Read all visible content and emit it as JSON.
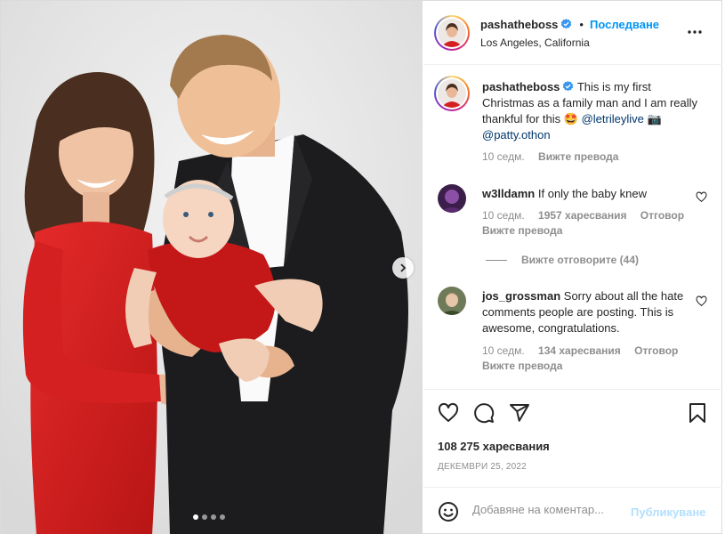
{
  "post": {
    "username": "pashatheboss",
    "follow_label": "Последване",
    "separator": "•",
    "location": "Los Angeles, California"
  },
  "caption": {
    "username": "pashatheboss",
    "text_part1": "This is my first Christmas as a family man and I am really thankful for this",
    "emoji1": "🤩",
    "mention1": "@letrileylive",
    "emoji2": "📷",
    "mention2": "@patty.othon",
    "time": "10 седм.",
    "translate": "Вижте превода"
  },
  "comments": [
    {
      "username": "w3lldamn",
      "text": "If only the baby knew",
      "time": "10 седм.",
      "likes": "1957 харесвания",
      "reply": "Отговор",
      "translate": "Вижте превода",
      "view_replies": "Вижте отговорите (44)"
    },
    {
      "username": "jos_grossman",
      "text": "Sorry about all the hate comments people are posting. This is awesome, congratulations.",
      "time": "10 седм.",
      "likes": "134 харесвания",
      "reply": "Отговор",
      "translate": "Вижте превода"
    }
  ],
  "likes_count": "108 275 харесвания",
  "date": "ДЕКЕМВРИ 25, 2022",
  "add_comment": {
    "placeholder": "Добавяне на коментар...",
    "post_label": "Публикуване"
  },
  "carousel": {
    "slides": 4,
    "active_index": 0
  },
  "colors": {
    "accent": "#0095f6",
    "post_disabled": "#b2dffc",
    "mention": "#00376b",
    "secondary_text": "#8e8e8e",
    "dress": "#d81f1f"
  }
}
